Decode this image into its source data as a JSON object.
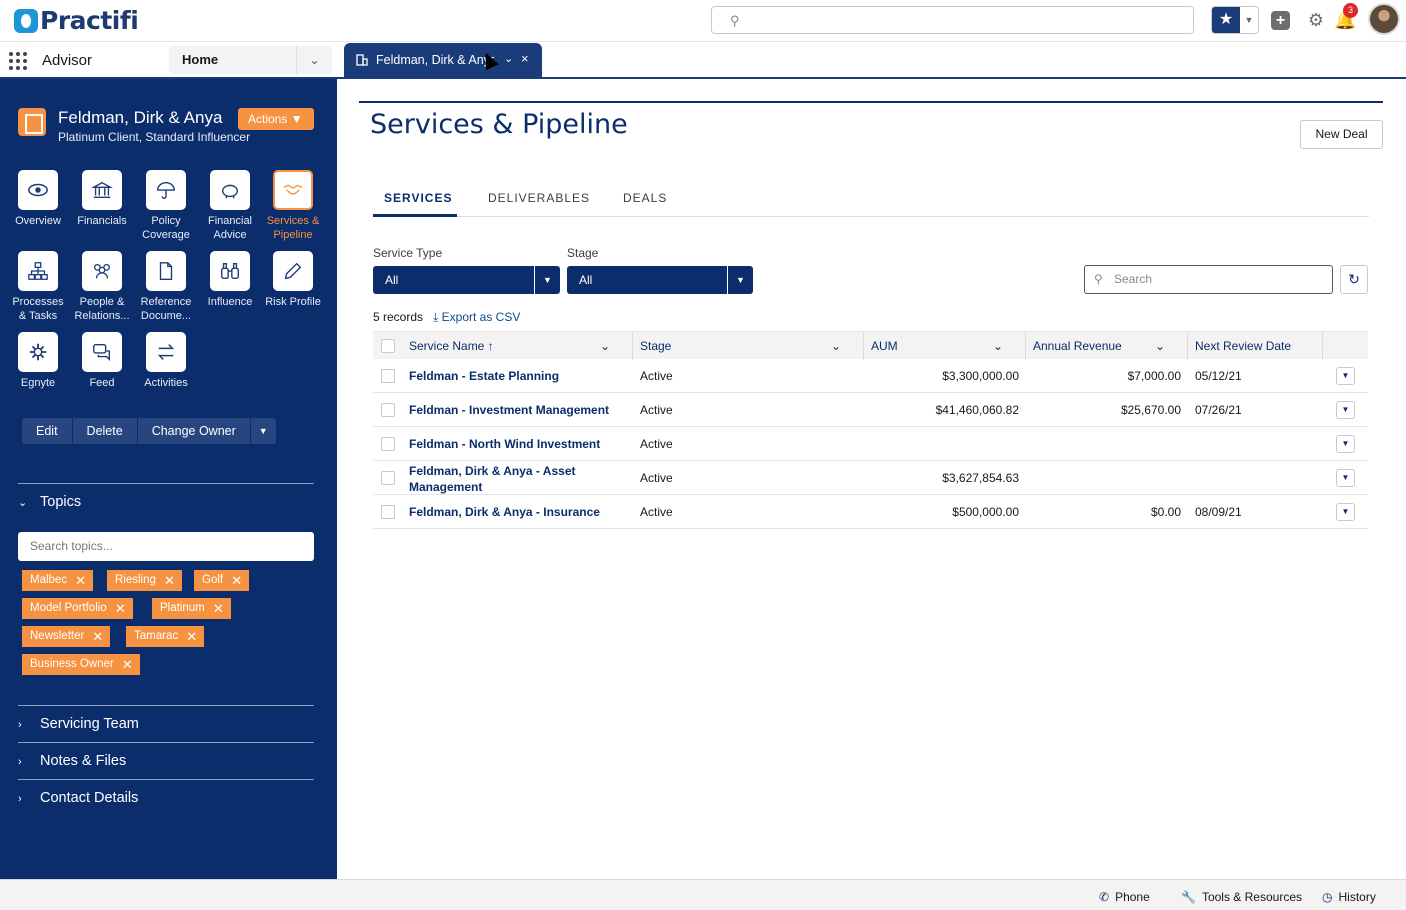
{
  "header": {
    "logo_text": "Practifi",
    "search_placeholder": "",
    "notification_count": "3"
  },
  "appbar": {
    "app_name": "Advisor",
    "nav_item": "Home",
    "record_tab_label": "Feldman, Dirk & Anya"
  },
  "sidebar": {
    "account_name": "Feldman, Dirk & Anya",
    "account_subtitle": "Platinum Client, Standard Influencer",
    "actions_label": "Actions",
    "tiles": [
      {
        "label": "Overview",
        "icon": "eye-icon"
      },
      {
        "label": "Financials",
        "icon": "bank-icon"
      },
      {
        "label": "Policy\nCoverage",
        "icon": "umbrella-icon"
      },
      {
        "label": "Financial\nAdvice",
        "icon": "piggy-bank-icon"
      },
      {
        "label": "Services &\nPipeline",
        "icon": "handshake-icon"
      },
      {
        "label": "Processes\n& Tasks",
        "icon": "hierarchy-icon"
      },
      {
        "label": "People &\nRelations...",
        "icon": "people-icon"
      },
      {
        "label": "Reference\nDocume...",
        "icon": "document-icon"
      },
      {
        "label": "Influence",
        "icon": "binoculars-icon"
      },
      {
        "label": "Risk Profile",
        "icon": "pencil-icon"
      },
      {
        "label": "Egnyte",
        "icon": "egnyte-icon"
      },
      {
        "label": "Feed",
        "icon": "chat-icon"
      },
      {
        "label": "Activities",
        "icon": "swap-icon"
      }
    ],
    "buttons": {
      "edit": "Edit",
      "delete": "Delete",
      "change_owner": "Change Owner"
    },
    "topics_title": "Topics",
    "topic_search_placeholder": "Search topics...",
    "tags": [
      "Malbec",
      "Riesling",
      "Golf",
      "Model Portfolio",
      "Platinum",
      "Newsletter",
      "Tamarac",
      "Business Owner"
    ],
    "sections": [
      "Servicing Team",
      "Notes & Files",
      "Contact Details"
    ]
  },
  "main": {
    "title": "Services & Pipeline",
    "new_deal": "New Deal",
    "tabs": [
      "SERVICES",
      "DELIVERABLES",
      "DEALS"
    ],
    "filters": {
      "service_type_label": "Service Type",
      "service_type_value": "All",
      "stage_label": "Stage",
      "stage_value": "All"
    },
    "search_placeholder": "Search",
    "records_count": "5 records",
    "export_label": "Export as CSV",
    "columns": [
      "Service Name",
      "Stage",
      "AUM",
      "Annual Revenue",
      "Next Review Date"
    ],
    "rows": [
      {
        "name": "Feldman - Estate Planning",
        "name2": "",
        "stage": "Active",
        "aum": "$3,300,000.00",
        "revenue": "$7,000.00",
        "review": "05/12/21"
      },
      {
        "name": "Feldman - Investment Management",
        "name2": "",
        "stage": "Active",
        "aum": "$41,460,060.82",
        "revenue": "$25,670.00",
        "review": "07/26/21"
      },
      {
        "name": "Feldman - North Wind Investment",
        "name2": "",
        "stage": "Active",
        "aum": "",
        "revenue": "",
        "review": ""
      },
      {
        "name": "Feldman, Dirk & Anya - Asset",
        "name2": "Management",
        "stage": "Active",
        "aum": "$3,627,854.63",
        "revenue": "",
        "review": ""
      },
      {
        "name": "Feldman, Dirk & Anya - Insurance",
        "name2": "",
        "stage": "Active",
        "aum": "$500,000.00",
        "revenue": "$0.00",
        "review": "08/09/21"
      }
    ]
  },
  "utility_bar": {
    "phone": "Phone",
    "tools": "Tools & Resources",
    "history": "History"
  }
}
